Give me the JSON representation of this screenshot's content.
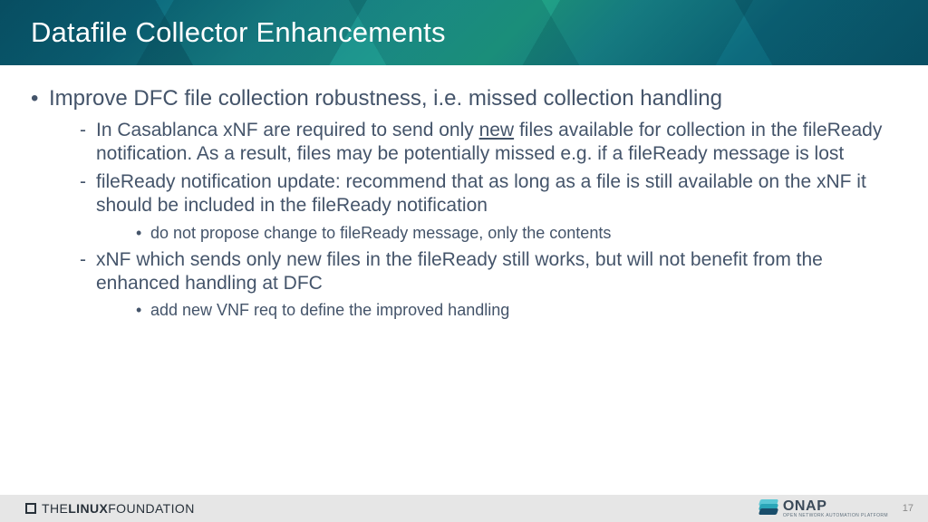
{
  "header": {
    "title": "Datafile Collector Enhancements"
  },
  "content": {
    "top": "Improve DFC file collection robustness, i.e. missed collection handling",
    "s1a_pre": "In Casablanca xNF are required to send only ",
    "s1a_u": "new",
    "s1a_post": " files available for collection in the fileReady notification.  As a result, files may be potentially missed e.g. if a fileReady message is lost",
    "s1b": "fileReady notification update: recommend that as long as a file is still available on the xNF it should be included in the fileReady notification",
    "s1b_sub": "do not propose change to fileReady message, only the contents",
    "s1c": "xNF which sends only new files in the fileReady still works, but will not benefit from the enhanced handling at DFC",
    "s1c_sub": "add new VNF req to define the improved handling"
  },
  "footer": {
    "lf_the": "THE",
    "lf_linux": "LINUX",
    "lf_found": "FOUNDATION",
    "onap_main": "ONAP",
    "onap_sub": "OPEN NETWORK AUTOMATION PLATFORM",
    "page": "17"
  }
}
